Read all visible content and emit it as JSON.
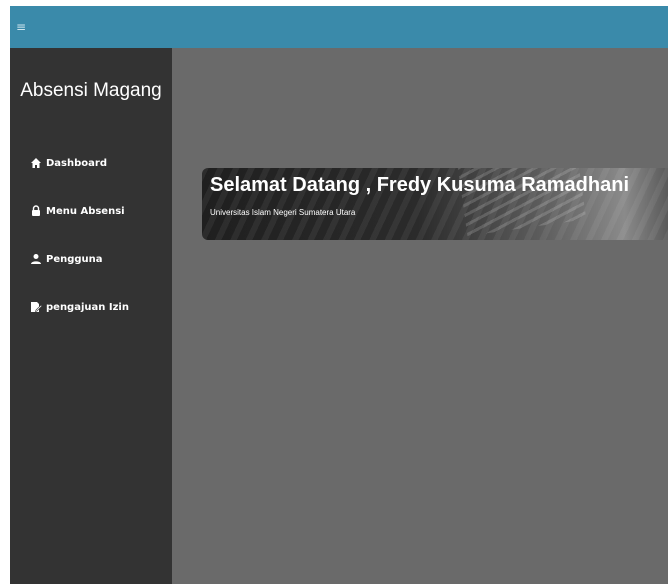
{
  "topbar": {
    "menu_icon": "hamburger-icon",
    "menu_glyph": "≡",
    "color": "#3a8aaa"
  },
  "sidebar": {
    "brand": "Absensi Magang",
    "items": [
      {
        "label": "Dashboard",
        "icon": "home-icon"
      },
      {
        "label": "Menu Absensi",
        "icon": "lock-icon"
      },
      {
        "label": "Pengguna",
        "icon": "user-icon"
      },
      {
        "label": "pengajuan Izin",
        "icon": "edit-document-icon"
      }
    ],
    "background": "#333333"
  },
  "main": {
    "background": "#6a6a6a",
    "banner": {
      "title": "Selamat Datang , Fredy Kusuma Ramadhani",
      "subtitle": "Universitas Islam Negeri Sumatera Utara"
    }
  }
}
